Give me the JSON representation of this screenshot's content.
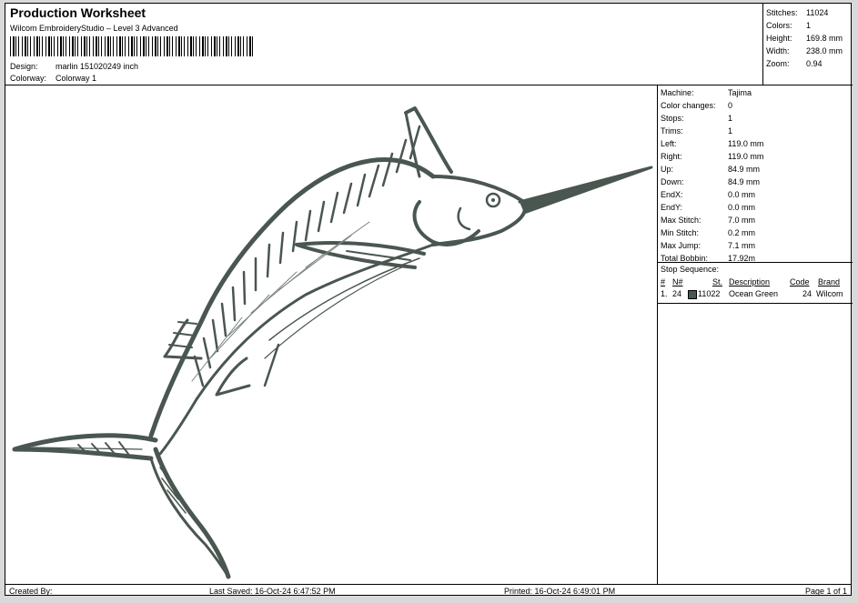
{
  "header": {
    "title": "Production Worksheet",
    "subtitle": "Wilcom EmbroideryStudio – Level 3 Advanced",
    "design_label": "Design:",
    "design_value": "marlin 151020249 inch",
    "colorway_label": "Colorway:",
    "colorway_value": "Colorway 1"
  },
  "stats": [
    {
      "label": "Stitches:",
      "value": "11024"
    },
    {
      "label": "Colors:",
      "value": "1"
    },
    {
      "label": "Height:",
      "value": "169.8 mm"
    },
    {
      "label": "Width:",
      "value": "238.0 mm"
    },
    {
      "label": "Zoom:",
      "value": "0.94"
    }
  ],
  "info": [
    {
      "label": "Machine:",
      "value": "Tajima"
    },
    {
      "label": "Color changes:",
      "value": "0"
    },
    {
      "label": "Stops:",
      "value": "1"
    },
    {
      "label": "Trims:",
      "value": "1"
    },
    {
      "label": "Left:",
      "value": "119.0 mm"
    },
    {
      "label": "Right:",
      "value": "119.0 mm"
    },
    {
      "label": "Up:",
      "value": "84.9 mm"
    },
    {
      "label": "Down:",
      "value": "84.9 mm"
    },
    {
      "label": "EndX:",
      "value": "0.0 mm"
    },
    {
      "label": "EndY:",
      "value": "0.0 mm"
    },
    {
      "label": "Max Stitch:",
      "value": "7.0 mm"
    },
    {
      "label": "Min Stitch:",
      "value": "0.2 mm"
    },
    {
      "label": "Max Jump:",
      "value": "7.1 mm"
    },
    {
      "label": "Total Bobbin:",
      "value": "17.92m"
    }
  ],
  "stop_sequence": {
    "label": "Stop Sequence:",
    "headers": {
      "num": "#",
      "n": "N#",
      "st": "St.",
      "desc": "Description",
      "code": "Code",
      "brand": "Brand"
    },
    "row": {
      "num": "1.",
      "n": "24",
      "st": "11022",
      "desc": "Ocean Green",
      "code": "24",
      "brand": "Wilcom"
    },
    "thread_color": "#4a5650"
  },
  "footer": {
    "created": "Created By:",
    "saved": "Last Saved: 16-Oct-24 6:47:52 PM",
    "printed": "Printed: 16-Oct-24 6:49:01 PM",
    "page": "Page 1 of 1"
  },
  "colors": {
    "thread": "#4a5650",
    "paper": "#ffffff",
    "background": "#d9d9d9"
  }
}
